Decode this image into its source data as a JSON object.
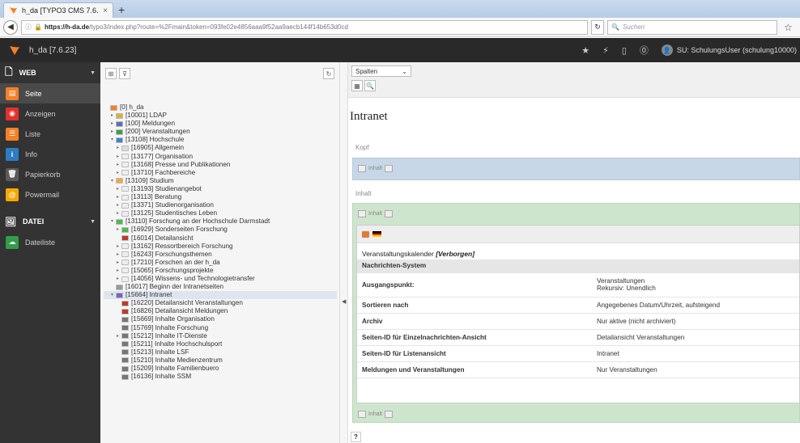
{
  "browser": {
    "tab_title": "h_da [TYPO3 CMS 7.6.23]",
    "tab_close": "×",
    "new_tab": "+",
    "url_host": "https://h-da.de",
    "url_path": "/typo3/index.php?route=%2Fmain&token=093fe02e4856aaa9f52aa9aecb144f14b653d0cd",
    "search_placeholder": "Suchen"
  },
  "topbar": {
    "site_title": "h_da [7.6.23]",
    "user_label": "SU: SchulungsUser (schulung10000)"
  },
  "sidebar": {
    "groups": [
      {
        "label": "WEB",
        "items": [
          {
            "label": "Seite",
            "color": "#f58025"
          },
          {
            "label": "Anzeigen",
            "color": "#e4312b"
          },
          {
            "label": "Liste",
            "color": "#f58025"
          },
          {
            "label": "Info",
            "color": "#2e7cc1"
          },
          {
            "label": "Papierkorb",
            "color": "#5a5a5a"
          },
          {
            "label": "Powermail",
            "color": "#f7a800"
          }
        ]
      },
      {
        "label": "DATEI",
        "items": [
          {
            "label": "Dateiliste",
            "color": "#2e9e48"
          }
        ]
      }
    ]
  },
  "tree": {
    "nodes": [
      {
        "label": "[0] h_da",
        "level": 0,
        "toggle": "",
        "color": "#f58025"
      },
      {
        "label": "[10001] LDAP",
        "level": 1,
        "toggle": "▸",
        "color": "#d7b33a"
      },
      {
        "label": "[100] Meldungen",
        "level": 1,
        "toggle": "▸",
        "color": "#5b6fb8"
      },
      {
        "label": "[200] Veranstaltungen",
        "level": 1,
        "toggle": "▸",
        "color": "#3aa14a"
      },
      {
        "label": "[13108] Hochschule",
        "level": 1,
        "toggle": "▾",
        "color": "#3d84d2"
      },
      {
        "label": "[16905] Allgemein",
        "level": 2,
        "toggle": "▸",
        "color": "#dddddd"
      },
      {
        "label": "[13177] Organisation",
        "level": 2,
        "toggle": "▸",
        "color": "#eeeeee"
      },
      {
        "label": "[13168] Presse und Publikationen",
        "level": 2,
        "toggle": "▸",
        "color": "#eeeeee"
      },
      {
        "label": "[13710] Fachbereiche",
        "level": 2,
        "toggle": "▸",
        "color": "#eeeeee"
      },
      {
        "label": "[13109] Studium",
        "level": 1,
        "toggle": "▾",
        "color": "#f4a83a"
      },
      {
        "label": "[13193] Studienangebot",
        "level": 2,
        "toggle": "▸",
        "color": "#eeeeee"
      },
      {
        "label": "[13113] Beratung",
        "level": 2,
        "toggle": "▸",
        "color": "#eeeeee"
      },
      {
        "label": "[13371] Studienorganisation",
        "level": 2,
        "toggle": "▸",
        "color": "#eeeeee"
      },
      {
        "label": "[13125] Studentisches Leben",
        "level": 2,
        "toggle": "▸",
        "color": "#eeeeee"
      },
      {
        "label": "[13110] Forschung an der Hochschule Darmstadt",
        "level": 1,
        "toggle": "▾",
        "color": "#4fb84f"
      },
      {
        "label": "[16929] Sonderseiten Forschung",
        "level": 2,
        "toggle": "▸",
        "color": "#4fb84f"
      },
      {
        "label": "[16014] Detailansicht",
        "level": 2,
        "toggle": "",
        "color": "#c0392b"
      },
      {
        "label": "[13162] Ressortbereich Forschung",
        "level": 2,
        "toggle": "▸",
        "color": "#eeeeee"
      },
      {
        "label": "[16243] Forschungsthemen",
        "level": 2,
        "toggle": "▸",
        "color": "#eeeeee"
      },
      {
        "label": "[17210] Forschen an der h_da",
        "level": 2,
        "toggle": "▸",
        "color": "#eeeeee"
      },
      {
        "label": "[15065] Forschungsprojekte",
        "level": 2,
        "toggle": "▸",
        "color": "#eeeeee"
      },
      {
        "label": "[14056] Wissens- und Technologietransfer",
        "level": 2,
        "toggle": "▸",
        "color": "#eeeeee"
      },
      {
        "label": "[16017] Beginn der Intranetseiten",
        "level": 1,
        "toggle": "",
        "color": "#999999"
      },
      {
        "label": "[15664] Intranet",
        "level": 1,
        "toggle": "▾",
        "color": "#7a5fc4",
        "selected": true
      },
      {
        "label": "[16220] Detailansicht Veranstaltungen",
        "level": 2,
        "toggle": "",
        "color": "#c0392b"
      },
      {
        "label": "[16826] Detailansicht Meldungen",
        "level": 2,
        "toggle": "",
        "color": "#c0392b"
      },
      {
        "label": "[15669] Inhalte Organisation",
        "level": 2,
        "toggle": "",
        "color": "#777777"
      },
      {
        "label": "[15769] Inhalte Forschung",
        "level": 2,
        "toggle": "",
        "color": "#777777"
      },
      {
        "label": "[15212] Inhalte IT-Dienste",
        "level": 2,
        "toggle": "▸",
        "color": "#777777"
      },
      {
        "label": "[15211] Inhalte Hochschulsport",
        "level": 2,
        "toggle": "",
        "color": "#777777"
      },
      {
        "label": "[15213] Inhalte LSF",
        "level": 2,
        "toggle": "",
        "color": "#777777"
      },
      {
        "label": "[15210] Inhalte Medienzentrum",
        "level": 2,
        "toggle": "",
        "color": "#777777"
      },
      {
        "label": "[15209] Inhalte Familienbuero",
        "level": 2,
        "toggle": "",
        "color": "#777777"
      },
      {
        "label": "[16136] Inhalte SSM",
        "level": 2,
        "toggle": "",
        "color": "#777777"
      }
    ]
  },
  "content": {
    "view_select": "Spalten",
    "page_title": "Intranet",
    "section_kopf": "Kopf",
    "section_inhalt": "Inhalt",
    "new_content_label": "Inhalt",
    "element": {
      "title": "Veranstaltungskalender",
      "hidden_flag": "[Verborgen]",
      "rows": [
        {
          "key": "Nachrichten-System",
          "value": "",
          "header": true
        },
        {
          "key": "Ausgangspunkt:",
          "value": "Veranstaltungen",
          "value2": "Rekursiv: Unendlich"
        },
        {
          "key": "Sortieren nach",
          "value": "Angegebenes Datum/Uhrzeit, aufsteigend"
        },
        {
          "key": "Archiv",
          "value": "Nur aktive (nicht archiviert)"
        },
        {
          "key": "Seiten-ID für Einzelnachrichten-Ansicht",
          "value": "Detailansicht Veranstaltungen"
        },
        {
          "key": "Seiten-ID für Listenansicht",
          "value": "Intranet"
        },
        {
          "key": "Meldungen und Veranstaltungen",
          "value": "Nur Veranstaltungen"
        }
      ]
    },
    "help_label": "?"
  }
}
